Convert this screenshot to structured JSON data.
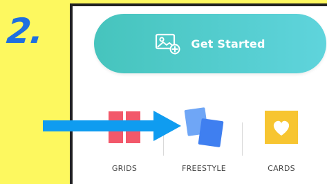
{
  "step": {
    "number": "2."
  },
  "app": {
    "get_started": {
      "label": "Get Started",
      "icon": "add-image-icon",
      "gradient": [
        "#46c4bd",
        "#5fd4dc"
      ]
    },
    "options": [
      {
        "label": "GRIDS",
        "icon": "grid-icon",
        "color": "#f2586a"
      },
      {
        "label": "FREESTYLE",
        "icon": "freestyle-icon",
        "color": "#4f8bf0"
      },
      {
        "label": "CARDS",
        "icon": "heart-card-icon",
        "color": "#f7c531"
      }
    ]
  },
  "annotation": {
    "arrow_color": "#0f9cf0",
    "background_color": "#fdf85f",
    "step_color": "#1e6fe0"
  }
}
